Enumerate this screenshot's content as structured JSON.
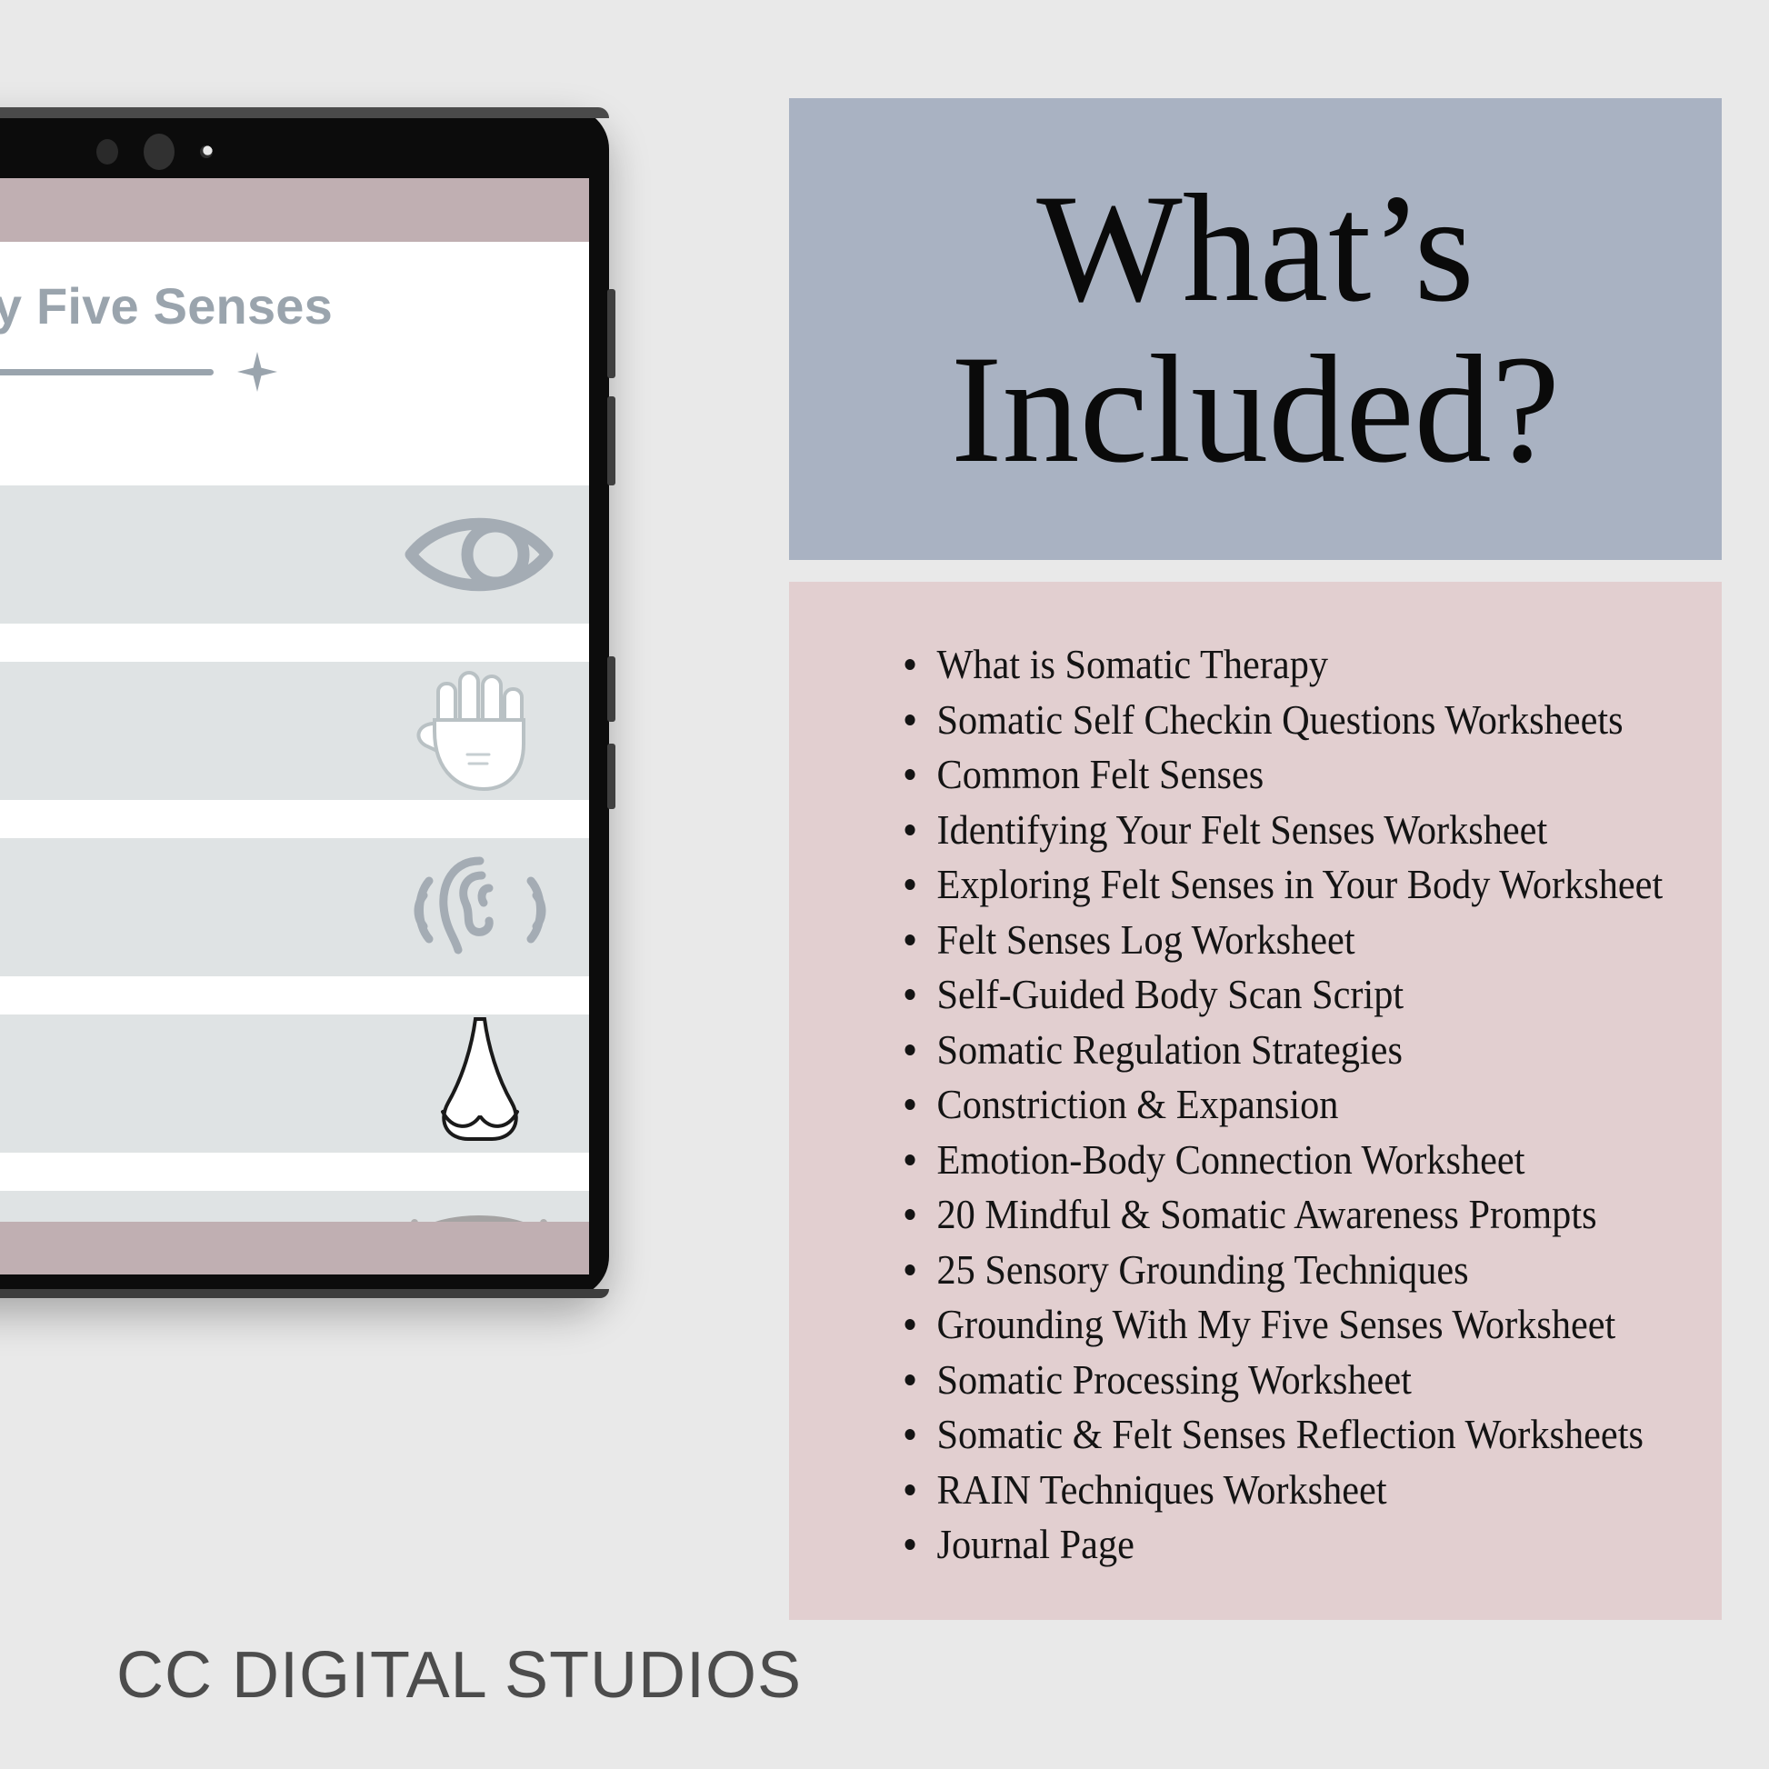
{
  "background_color": "#e9e9e9",
  "colors": {
    "heading_panel": "#a9b2c2",
    "list_panel": "#e2cfd0",
    "device_frame": "#0c0c0c",
    "sheet_accent_bar": "#c0afb2",
    "sheet_row": "#dfe3e4",
    "sheet_title_text": "#9aa4ad",
    "brand_text": "#4c4c4c",
    "list_text": "#141414"
  },
  "heading": {
    "line1": "What’s",
    "line2": "Included?"
  },
  "included_list": [
    "What is Somatic Therapy",
    "Somatic Self Checkin Questions Worksheets",
    "Common Felt Senses",
    "Identifying Your Felt Senses Worksheet",
    "Exploring Felt Senses in Your Body Worksheet",
    "Felt Senses Log Worksheet",
    "Self-Guided Body Scan Script",
    "Somatic Regulation Strategies",
    "Constriction & Expansion",
    "Emotion-Body Connection Worksheet",
    "20 Mindful & Somatic Awareness Prompts",
    "25 Sensory Grounding Techniques",
    "Grounding With My Five Senses Worksheet",
    "Somatic Processing Worksheet",
    "Somatic & Felt Senses Reflection Worksheets",
    "RAIN Techniques Worksheet",
    "Journal Page"
  ],
  "tablet": {
    "worksheet_title": "ding With My Five Senses",
    "rows": [
      {
        "icon": "eye-icon"
      },
      {
        "icon": "hand-icon"
      },
      {
        "icon": "ear-icon"
      },
      {
        "icon": "nose-icon"
      },
      {
        "icon": "tongue-icon"
      }
    ]
  },
  "brand": "CC DIGITAL STUDIOS"
}
